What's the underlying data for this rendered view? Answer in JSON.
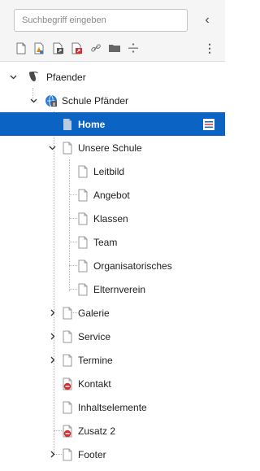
{
  "search": {
    "placeholder": "Suchbegriff eingeben"
  },
  "toolbar": {
    "collapse_label": "‹",
    "more_label": "⋮",
    "icons": [
      "new-page-icon",
      "new-page-from-template-icon",
      "new-shortcut-page-icon",
      "new-external-link-page-icon",
      "link-icon",
      "folder-icon",
      "divider-icon"
    ]
  },
  "tree": {
    "root": "Pfaender",
    "site": "Schule Pfänder",
    "items": [
      {
        "label": "Home"
      },
      {
        "label": "Unsere Schule"
      },
      {
        "label": "Leitbild"
      },
      {
        "label": "Angebot"
      },
      {
        "label": "Klassen"
      },
      {
        "label": "Team"
      },
      {
        "label": "Organisatorisches"
      },
      {
        "label": "Elternverein"
      },
      {
        "label": "Galerie"
      },
      {
        "label": "Service"
      },
      {
        "label": "Termine"
      },
      {
        "label": "Kontakt"
      },
      {
        "label": "Inhaltselemente"
      },
      {
        "label": "Zusatz 2"
      },
      {
        "label": "Footer"
      }
    ]
  },
  "colors": {
    "selected_bg": "#0b64c4",
    "page_icon": "#9a9a9a",
    "hidden_badge": "#d32f2f",
    "typo3_logo": "#4a4a4a"
  }
}
